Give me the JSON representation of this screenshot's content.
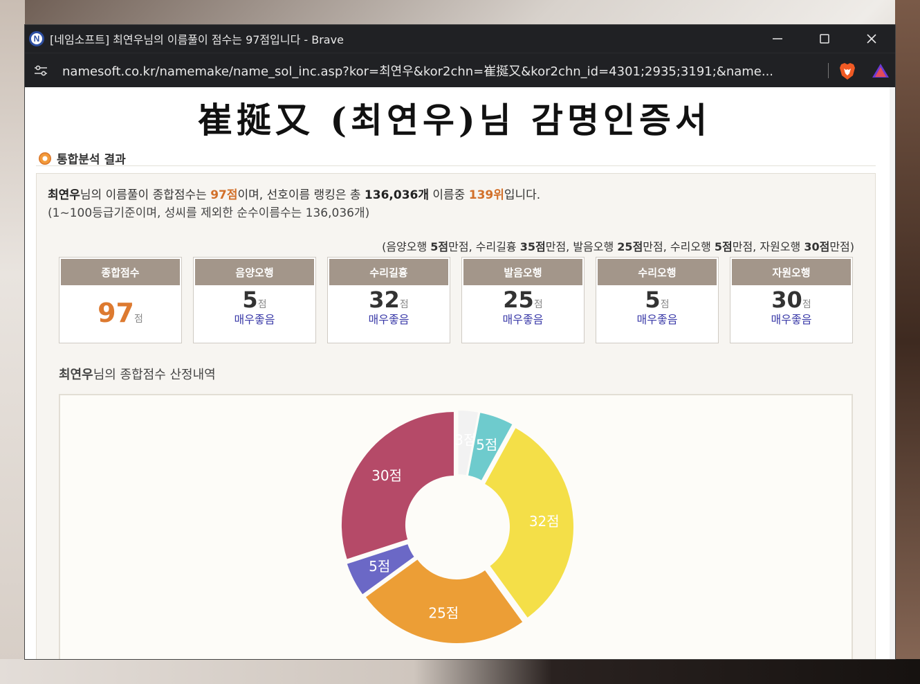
{
  "window": {
    "title": "[네임소프트] 최연우님의 이름풀이 점수는 97점입니다 - Brave",
    "url": "namesoft.co.kr/namemake/name_sol_inc.asp?kor=최연우&kor2chn=崔挻又&kor2chn_id=4301;2935;3191;&name..."
  },
  "page": {
    "cert_title": "崔挻又 (최연우)님 감명인증서",
    "section_title": "통합분석 결과",
    "summary": {
      "name": "최연우",
      "t1": "님의 이름풀이 종합점수는 ",
      "score": "97점",
      "t2": "이며, 선호이름 랭킹은 총 ",
      "total_names": "136,036개",
      "t3": " 이름중 ",
      "rank": "139위",
      "t4": "입니다.",
      "line2": "(1~100등급기준이며, 성씨를 제외한 순수이름수는 136,036개)"
    },
    "max_note": {
      "open": "(",
      "p1": "음양오행 ",
      "v1": "5점",
      "p2": "만점, 수리길흉 ",
      "v2": "35점",
      "p3": "만점, 발음오행 ",
      "v3": "25점",
      "p4": "만점, 수리오행 ",
      "v4": "5점",
      "p5": "만점, 자원오행 ",
      "v5": "30점",
      "p6": "만점)"
    },
    "score_boxes": [
      {
        "label": "종합점수",
        "value": "97",
        "unit": "점",
        "grade": ""
      },
      {
        "label": "음양오행",
        "value": "5",
        "unit": "점",
        "grade": "매우좋음"
      },
      {
        "label": "수리길흉",
        "value": "32",
        "unit": "점",
        "grade": "매우좋음"
      },
      {
        "label": "발음오행",
        "value": "25",
        "unit": "점",
        "grade": "매우좋음"
      },
      {
        "label": "수리오행",
        "value": "5",
        "unit": "점",
        "grade": "매우좋음"
      },
      {
        "label": "자원오행",
        "value": "30",
        "unit": "점",
        "grade": "매우좋음"
      }
    ],
    "breakdown": {
      "name": "최연우",
      "text": "님의 종합점수 산정내역"
    }
  },
  "colors": {
    "accent_orange": "#d2702a",
    "header_brown": "#a3968a",
    "grade_blue": "#3a3aa8"
  },
  "chart_data": {
    "type": "pie",
    "donut": true,
    "slices": [
      {
        "value": 3,
        "label": "3점",
        "color": "#f2f2f2"
      },
      {
        "value": 5,
        "label": "5점",
        "color": "#6ecbcd"
      },
      {
        "value": 32,
        "label": "32점",
        "color": "#f4df48"
      },
      {
        "value": 25,
        "label": "25점",
        "color": "#ec9e36"
      },
      {
        "value": 5,
        "label": "5점",
        "color": "#6b68c6"
      },
      {
        "value": 30,
        "label": "30점",
        "color": "#b54a68"
      }
    ]
  }
}
